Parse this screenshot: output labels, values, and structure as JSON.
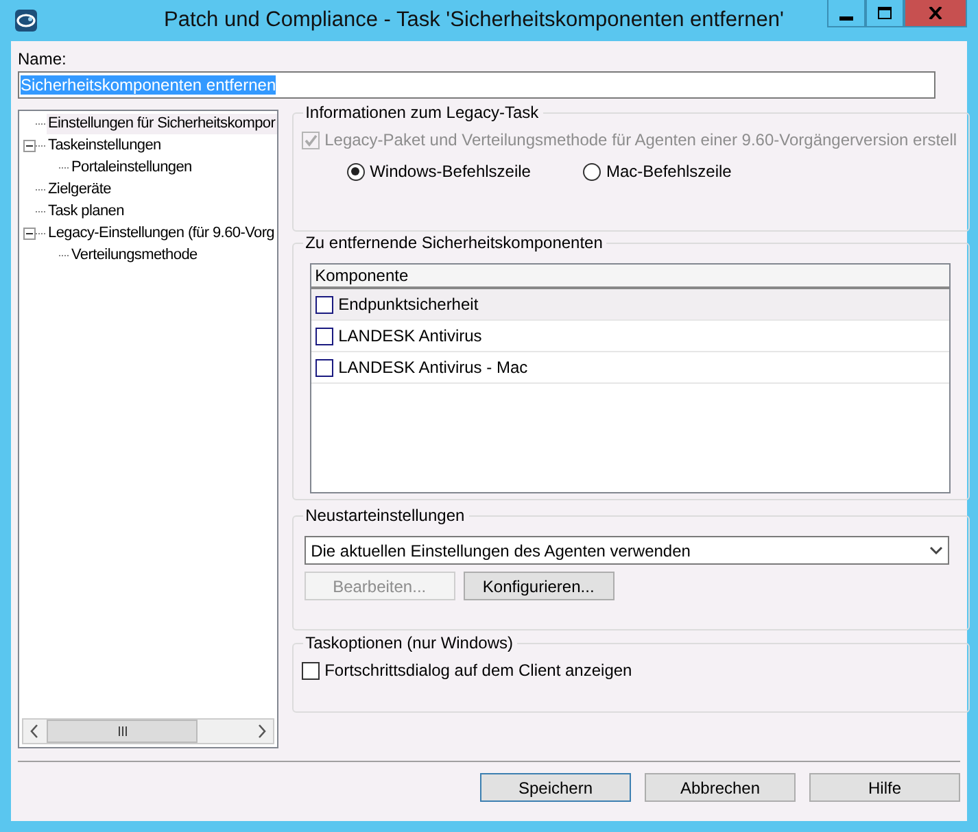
{
  "window": {
    "title": "Patch und Compliance - Task 'Sicherheitskomponenten entfernen'"
  },
  "name_field": {
    "label": "Name:",
    "value": "Sicherheitskomponenten entfernen"
  },
  "tree": {
    "items": [
      {
        "label": "Einstellungen für Sicherheitskompor",
        "selected": true
      },
      {
        "label": "Taskeinstellungen",
        "selected": false,
        "expanded": true,
        "children": [
          {
            "label": "Portaleinstellungen",
            "selected": false
          }
        ]
      },
      {
        "label": "Zielgeräte",
        "selected": false
      },
      {
        "label": "Task planen",
        "selected": false
      },
      {
        "label": "Legacy-Einstellungen (für 9.60-Vorg",
        "selected": false,
        "expanded": true,
        "children": [
          {
            "label": "Verteilungsmethode",
            "selected": false
          }
        ]
      }
    ]
  },
  "legacy_group": {
    "title": "Informationen zum Legacy-Task",
    "checkbox": {
      "label": "Legacy-Paket und Verteilungsmethode für Agenten einer 9.60-Vorgängerversion erstell",
      "checked": true,
      "disabled": true
    },
    "radios": [
      {
        "label": "Windows-Befehlszeile",
        "selected": true
      },
      {
        "label": "Mac-Befehlszeile",
        "selected": false
      }
    ]
  },
  "components_group": {
    "title": "Zu entfernende Sicherheitskomponenten",
    "table": {
      "columns": [
        "Komponente"
      ],
      "rows": [
        {
          "label": "Endpunktsicherheit",
          "checked": false,
          "selected": true
        },
        {
          "label": "LANDESK Antivirus",
          "checked": false,
          "selected": false
        },
        {
          "label": "LANDESK Antivirus - Mac",
          "checked": false,
          "selected": false
        }
      ]
    }
  },
  "restart_group": {
    "title": "Neustarteinstellungen",
    "dropdown": {
      "value": "Die aktuellen Einstellungen des Agenten verwenden"
    },
    "buttons": [
      {
        "label": "Bearbeiten...",
        "disabled": true
      },
      {
        "label": "Konfigurieren...",
        "disabled": false
      }
    ]
  },
  "task_options": {
    "title": "Taskoptionen (nur Windows)",
    "checkbox": {
      "label": "Fortschrittsdialog auf dem Client anzeigen",
      "checked": false
    }
  },
  "buttons": [
    {
      "label": "Speichern",
      "default": true
    },
    {
      "label": "Abbrechen",
      "default": false
    },
    {
      "label": "Hilfe",
      "default": false
    }
  ]
}
